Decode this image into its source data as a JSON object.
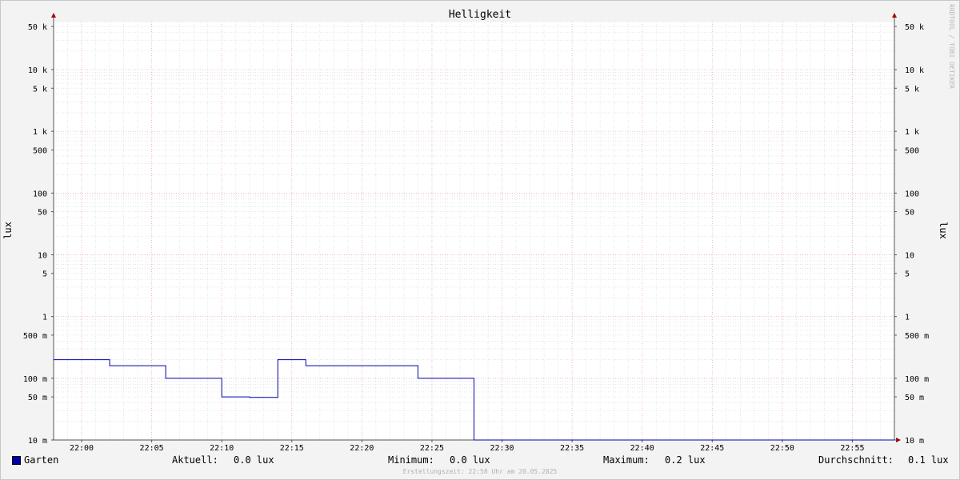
{
  "chart_data": {
    "type": "line",
    "title": "Helligkeit",
    "ylabel_left": "lux",
    "ylabel_right": "lux",
    "y_scale": "log",
    "ylim": [
      0.01,
      60000
    ],
    "x_range": [
      "21:58",
      "22:58"
    ],
    "x_ticks": [
      "22:00",
      "22:05",
      "22:10",
      "22:15",
      "22:20",
      "22:25",
      "22:30",
      "22:35",
      "22:40",
      "22:45",
      "22:50",
      "22:55"
    ],
    "y_ticks": [
      {
        "value": 50000,
        "label": "50 k"
      },
      {
        "value": 10000,
        "label": "10 k"
      },
      {
        "value": 5000,
        "label": "5 k"
      },
      {
        "value": 1000,
        "label": "1 k"
      },
      {
        "value": 500,
        "label": "500"
      },
      {
        "value": 100,
        "label": "100"
      },
      {
        "value": 50,
        "label": "50"
      },
      {
        "value": 10,
        "label": "10"
      },
      {
        "value": 5,
        "label": "5"
      },
      {
        "value": 1,
        "label": "1"
      },
      {
        "value": 0.5,
        "label": "500 m"
      },
      {
        "value": 0.1,
        "label": "100 m"
      },
      {
        "value": 0.05,
        "label": "50 m"
      },
      {
        "value": 0.01,
        "label": "10 m"
      }
    ],
    "series": [
      {
        "name": "Garten",
        "color": "#0000aa",
        "step_points": [
          [
            "21:58",
            0.2
          ],
          [
            "22:02",
            0.16
          ],
          [
            "22:06",
            0.1
          ],
          [
            "22:10",
            0.05
          ],
          [
            "22:12",
            0.049
          ],
          [
            "22:14",
            0.2
          ],
          [
            "22:16",
            0.16
          ],
          [
            "22:24",
            0.1
          ],
          [
            "22:28",
            0.01
          ],
          [
            "22:58",
            0.01
          ]
        ]
      }
    ],
    "grid": true
  },
  "legend": {
    "series_name": "Garten",
    "current_label": "Aktuell:",
    "current_value": "0.0 lux",
    "min_label": "Minimum:",
    "min_value": "0.0 lux",
    "max_label": "Maximum:",
    "max_value": "0.2 lux",
    "avg_label": "Durchschnitt:",
    "avg_value": "0.1 lux"
  },
  "footer": "Erstellungszeit: 22:58 Uhr am 20.05.2025",
  "watermark": "RRDTOOL / TOBI OETIKER"
}
